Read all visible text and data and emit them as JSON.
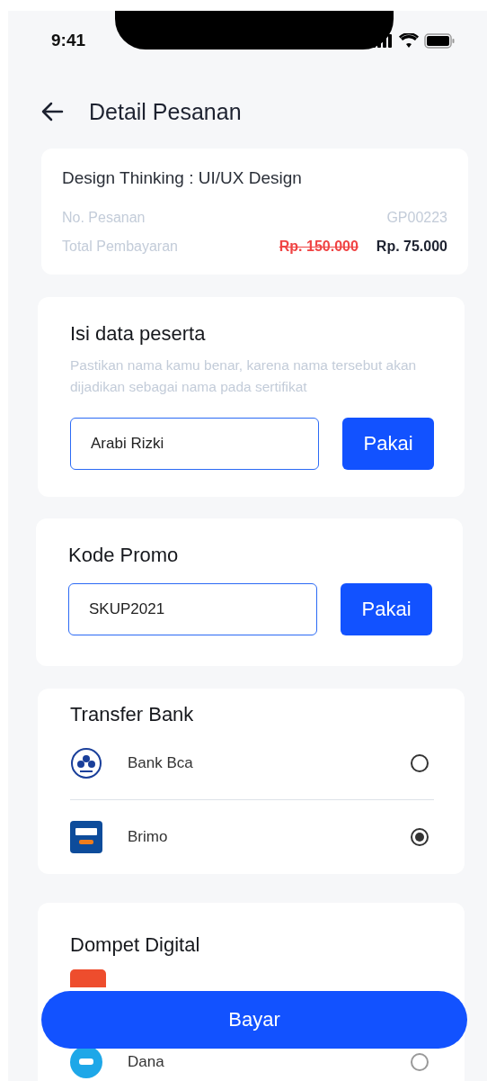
{
  "status_bar": {
    "time": "9:41"
  },
  "header": {
    "title": "Detail Pesanan"
  },
  "order": {
    "course": "Design Thinking : UI/UX Design",
    "rows": [
      {
        "label": "No. Pesanan",
        "value": "GP00223"
      },
      {
        "label": "Total Pembayaran",
        "old_price": "Rp. 150.000",
        "value": "Rp. 75.000"
      }
    ]
  },
  "participant": {
    "title": "Isi data peserta",
    "hint": "Pastikan nama kamu benar, karena nama tersebut akan dijadikan sebagai nama pada sertifikat",
    "value": "Arabi Rizki",
    "button": "Pakai"
  },
  "promo": {
    "title": "Kode Promo",
    "value": "SKUP2021",
    "button": "Pakai"
  },
  "transfer_bank": {
    "title": "Transfer Bank",
    "options": [
      {
        "kind": "bca",
        "name": "Bank Bca",
        "selected": false
      },
      {
        "kind": "bri",
        "name": "Brimo",
        "selected": true
      }
    ]
  },
  "digital_wallet": {
    "title": "Dompet Digital",
    "options": [
      {
        "kind": "orange"
      },
      {
        "kind": "blue",
        "name": "Dana",
        "selected": false
      }
    ]
  },
  "pay_button": "Bayar"
}
